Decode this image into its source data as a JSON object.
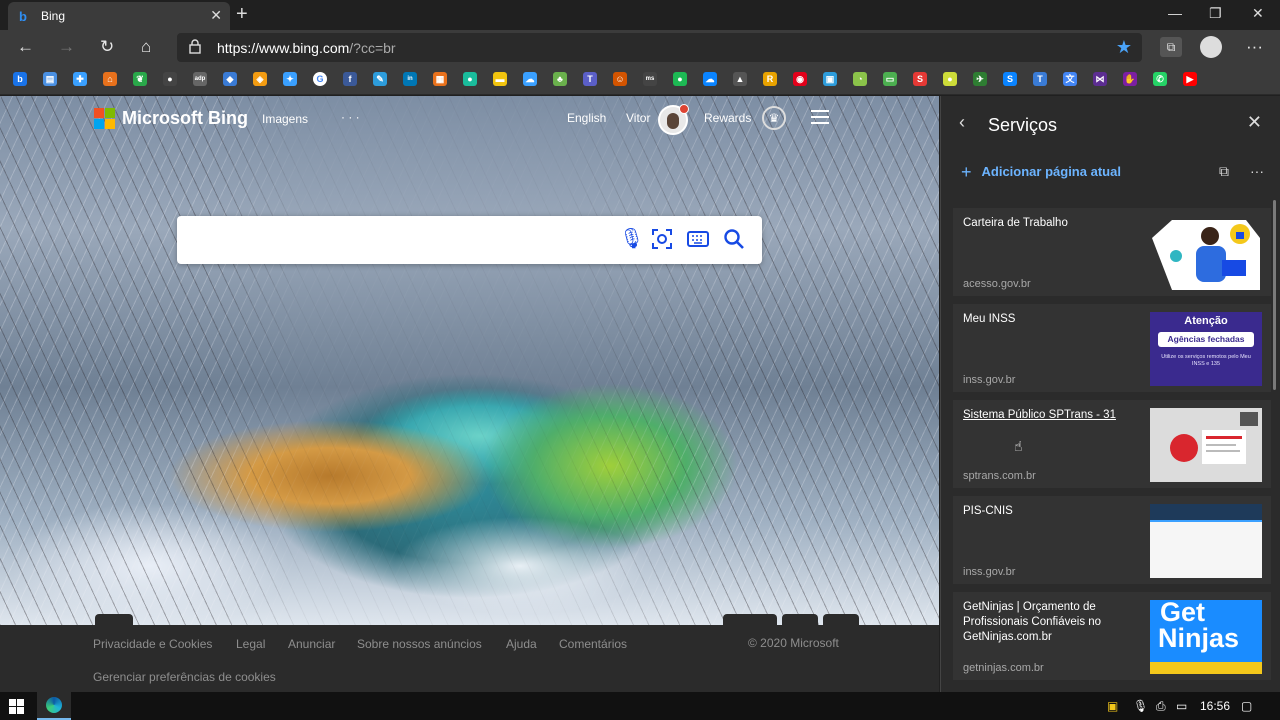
{
  "browser": {
    "tab_title": "Bing",
    "tab_favicon": "bing-icon",
    "url_main": "https://www.bing.com",
    "url_rest": "/?cc=br"
  },
  "favorites": [
    {
      "icon": "bing-icon",
      "color": "#1a73e8",
      "glyph": "b"
    },
    {
      "icon": "doc-icon",
      "color": "#4a90e2",
      "glyph": "▤"
    },
    {
      "icon": "plus-icon",
      "color": "#3aa0ff",
      "glyph": "✚"
    },
    {
      "icon": "home-icon",
      "color": "#e8711c",
      "glyph": "⌂"
    },
    {
      "icon": "leaf-icon",
      "color": "#2aa84a",
      "glyph": "❦"
    },
    {
      "icon": "circle-icon",
      "color": "#444",
      "glyph": "●"
    },
    {
      "icon": "adp-icon",
      "color": "#666",
      "glyph": "adp"
    },
    {
      "icon": "drop-icon",
      "color": "#3a7bd5",
      "glyph": "◆"
    },
    {
      "icon": "shield-icon",
      "color": "#f39c12",
      "glyph": "◈"
    },
    {
      "icon": "bird-icon",
      "color": "#3aa0ff",
      "glyph": "✦"
    },
    {
      "icon": "google-icon",
      "color": "#ffffff",
      "glyph": "G"
    },
    {
      "icon": "facebook-icon",
      "color": "#3b5998",
      "glyph": "f"
    },
    {
      "icon": "tool-icon",
      "color": "#2d9cdb",
      "glyph": "✎"
    },
    {
      "icon": "linkedin-icon",
      "color": "#0077b5",
      "glyph": "in"
    },
    {
      "icon": "slides-icon",
      "color": "#e8711c",
      "glyph": "▦"
    },
    {
      "icon": "chat-icon",
      "color": "#1abc9c",
      "glyph": "●"
    },
    {
      "icon": "bag-icon",
      "color": "#f1c40f",
      "glyph": "▬"
    },
    {
      "icon": "cloud-icon",
      "color": "#3aa0ff",
      "glyph": "☁"
    },
    {
      "icon": "tree-icon",
      "color": "#6ab04c",
      "glyph": "♣"
    },
    {
      "icon": "teams-icon",
      "color": "#5b5fc7",
      "glyph": "T"
    },
    {
      "icon": "person-icon",
      "color": "#d35400",
      "glyph": "☺"
    },
    {
      "icon": "ms-icon",
      "color": "#444",
      "glyph": "ms"
    },
    {
      "icon": "spotify-icon",
      "color": "#1db954",
      "glyph": "●"
    },
    {
      "icon": "onedrive-icon",
      "color": "#0a84ff",
      "glyph": "☁"
    },
    {
      "icon": "playstation-icon",
      "color": "#555",
      "glyph": "▲"
    },
    {
      "icon": "r-icon",
      "color": "#e8a200",
      "glyph": "R"
    },
    {
      "icon": "bank-icon",
      "color": "#e2001a",
      "glyph": "◉"
    },
    {
      "icon": "photo-icon",
      "color": "#2d9cdb",
      "glyph": "▣"
    },
    {
      "icon": "gauge-icon",
      "color": "#8bc34a",
      "glyph": "◔"
    },
    {
      "icon": "window-icon",
      "color": "#4caf50",
      "glyph": "▭"
    },
    {
      "icon": "s-icon",
      "color": "#e53935",
      "glyph": "S"
    },
    {
      "icon": "ball-icon",
      "color": "#cddc39",
      "glyph": "●"
    },
    {
      "icon": "pin-icon",
      "color": "#2e7d32",
      "glyph": "✈"
    },
    {
      "icon": "skype-icon",
      "color": "#0a84ff",
      "glyph": "S"
    },
    {
      "icon": "text-icon",
      "color": "#3a7bd5",
      "glyph": "T"
    },
    {
      "icon": "translate-icon",
      "color": "#4285f4",
      "glyph": "文"
    },
    {
      "icon": "vs-icon",
      "color": "#5c2d91",
      "glyph": "⋈"
    },
    {
      "icon": "hand-icon",
      "color": "#7b1fa2",
      "glyph": "✋"
    },
    {
      "icon": "whatsapp-icon",
      "color": "#25d366",
      "glyph": "✆"
    },
    {
      "icon": "youtube-icon",
      "color": "#ff0000",
      "glyph": "▶"
    }
  ],
  "bing": {
    "brand": "Microsoft Bing",
    "nav_images": "Imagens",
    "nav_more": "· · ·",
    "lang": "English",
    "user": "Vitor",
    "rewards": "Rewards",
    "search_placeholder": ""
  },
  "footer": {
    "links": [
      "Privacidade e Cookies",
      "Legal",
      "Anunciar",
      "Sobre nossos anúncios",
      "Ajuda",
      "Comentários"
    ],
    "copyright": "© 2020 Microsoft",
    "cookies": "Gerenciar preferências de cookies"
  },
  "panel": {
    "title": "Serviços",
    "add_label": "Adicionar página atual",
    "cards": [
      {
        "title": "Carteira de Trabalho",
        "domain": "acesso.gov.br"
      },
      {
        "title": "Meu INSS",
        "domain": "inss.gov.br",
        "thumb_title": "Atenção",
        "thumb_sub": "Agências fechadas",
        "thumb_note": "Utilize os serviços remotos pelo Meu INSS e 135"
      },
      {
        "title": "Sistema Público SPTrans - 31",
        "domain": "sptrans.com.br"
      },
      {
        "title": "PIS-CNIS",
        "domain": "inss.gov.br"
      },
      {
        "title": "GetNinjas | Orçamento de Profissionais Confiáveis no GetNinjas.com.br",
        "domain": "getninjas.com.br",
        "thumb_text1": "Get",
        "thumb_text2": "Ninjas"
      }
    ]
  },
  "taskbar": {
    "time": "16:56"
  }
}
